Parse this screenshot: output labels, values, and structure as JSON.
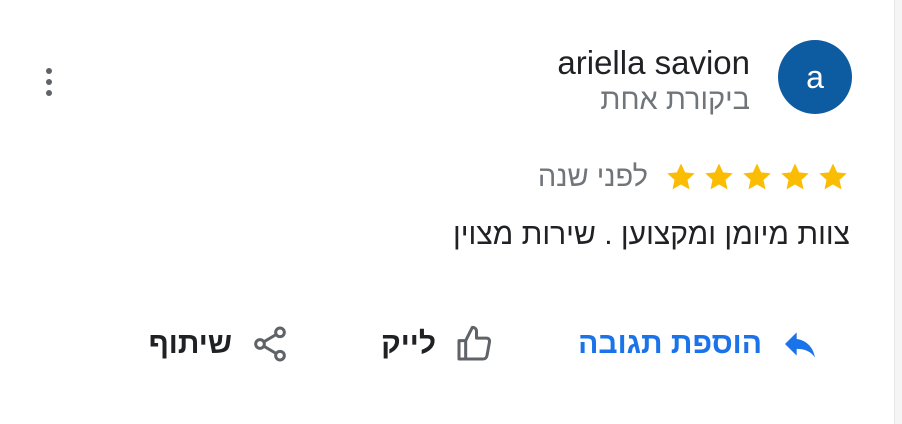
{
  "review": {
    "author": {
      "name": "ariella savion",
      "avatar_letter": "a",
      "avatar_color": "#0d5ba0",
      "review_count": "ביקורת אחת"
    },
    "rating": 5,
    "star_color": "#fbbc04",
    "date": "לפני שנה",
    "text": "צוות מיומן ומקצוען . שירות מצוין"
  },
  "actions": {
    "reply": {
      "label": "הוספת תגובה",
      "icon": "reply-icon",
      "color": "#1a73e8"
    },
    "like": {
      "label": "לייק",
      "icon": "thumbs-up-icon"
    },
    "share": {
      "label": "שיתוף",
      "icon": "share-icon"
    }
  },
  "menu": {
    "icon": "more-vertical-icon"
  }
}
